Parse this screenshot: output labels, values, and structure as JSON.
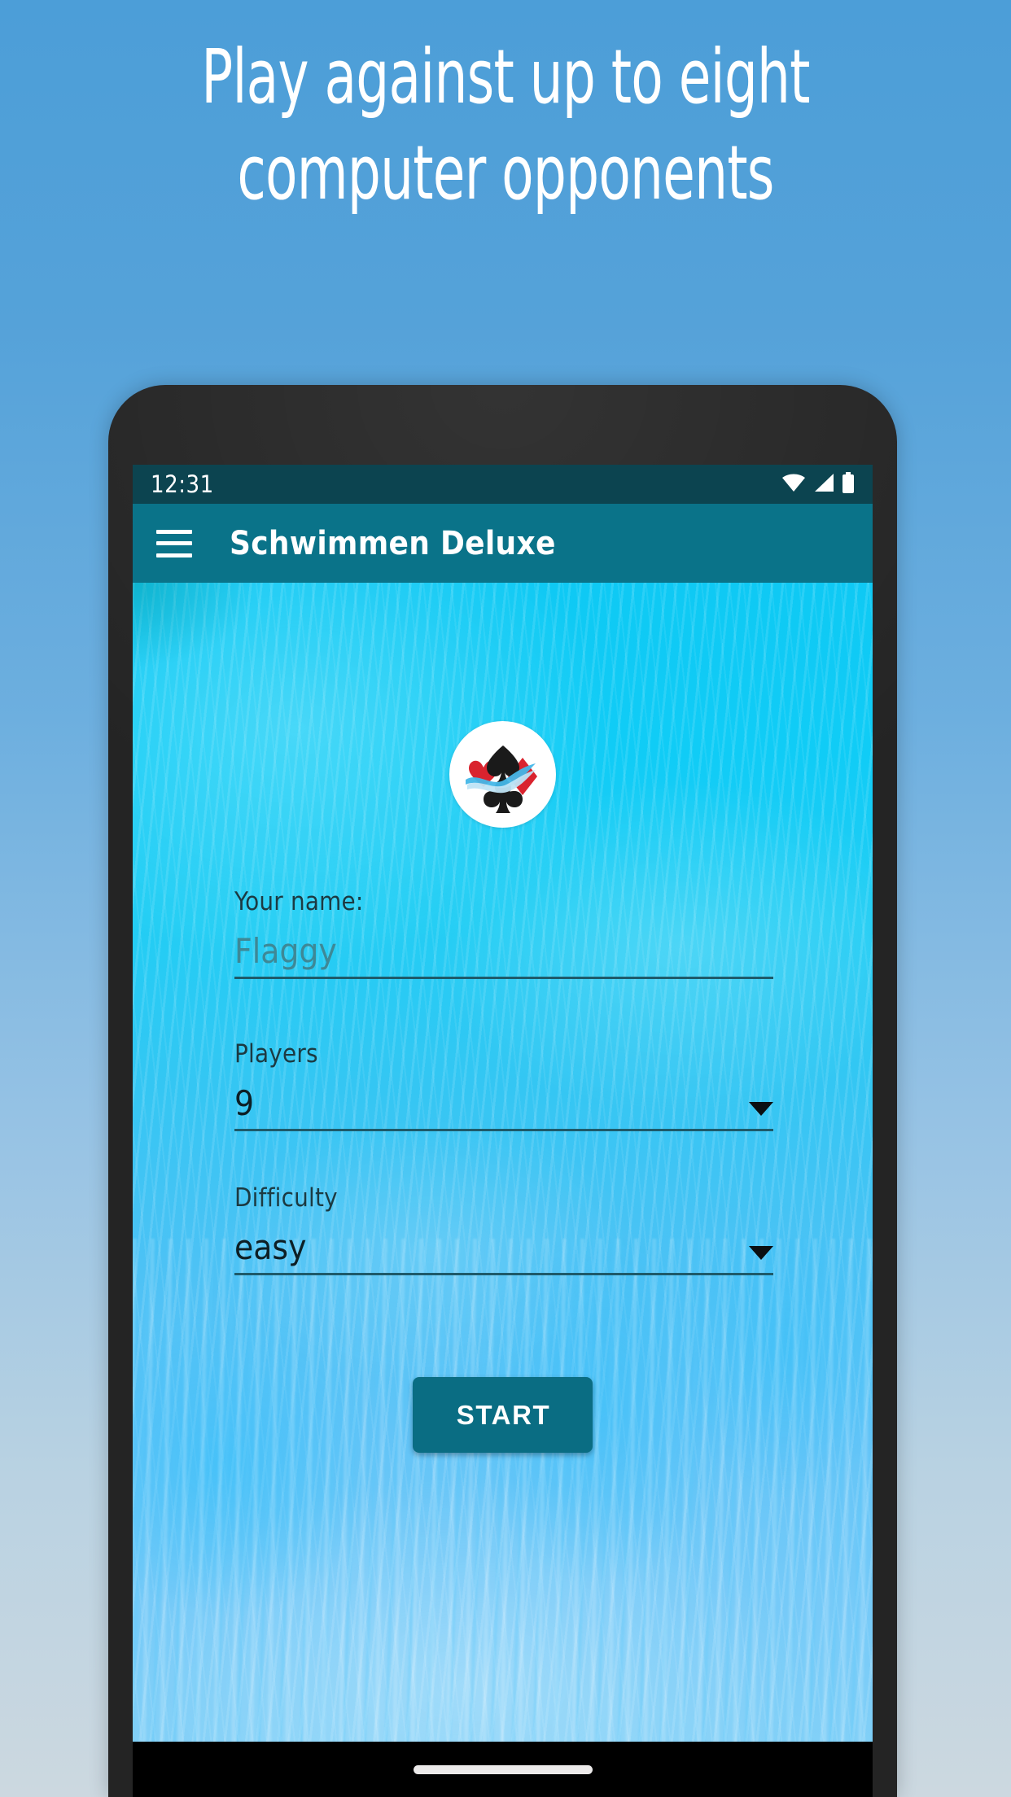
{
  "promo": {
    "headline_line1": "Play against up to eight",
    "headline_line2": "computer opponents",
    "background_top_color": "#4c9ed8",
    "background_bottom_color": "#ccd8e0"
  },
  "phone": {
    "status_bar": {
      "time": "12:31",
      "background_color": "#0c4450",
      "icons": [
        "wifi-icon",
        "cellular-signal-icon",
        "battery-icon"
      ]
    },
    "app_bar": {
      "menu_icon": "hamburger-menu-icon",
      "title": "Schwimmen Deluxe",
      "background_color": "#0a7389"
    },
    "screen": {
      "logo_icon": "card-suits-wave-logo",
      "form": {
        "name_field": {
          "label": "Your name:",
          "value": "Flaggy",
          "placeholder": "Flaggy"
        },
        "players_field": {
          "label": "Players",
          "value": "9",
          "dropdown_icon": "chevron-down-icon"
        },
        "difficulty_field": {
          "label": "Difficulty",
          "value": "easy",
          "dropdown_icon": "chevron-down-icon"
        },
        "start_button": {
          "label": "START",
          "color": "#0a6d83"
        }
      }
    },
    "nav_bar": {
      "gesture_pill": "home-gesture-pill"
    }
  }
}
